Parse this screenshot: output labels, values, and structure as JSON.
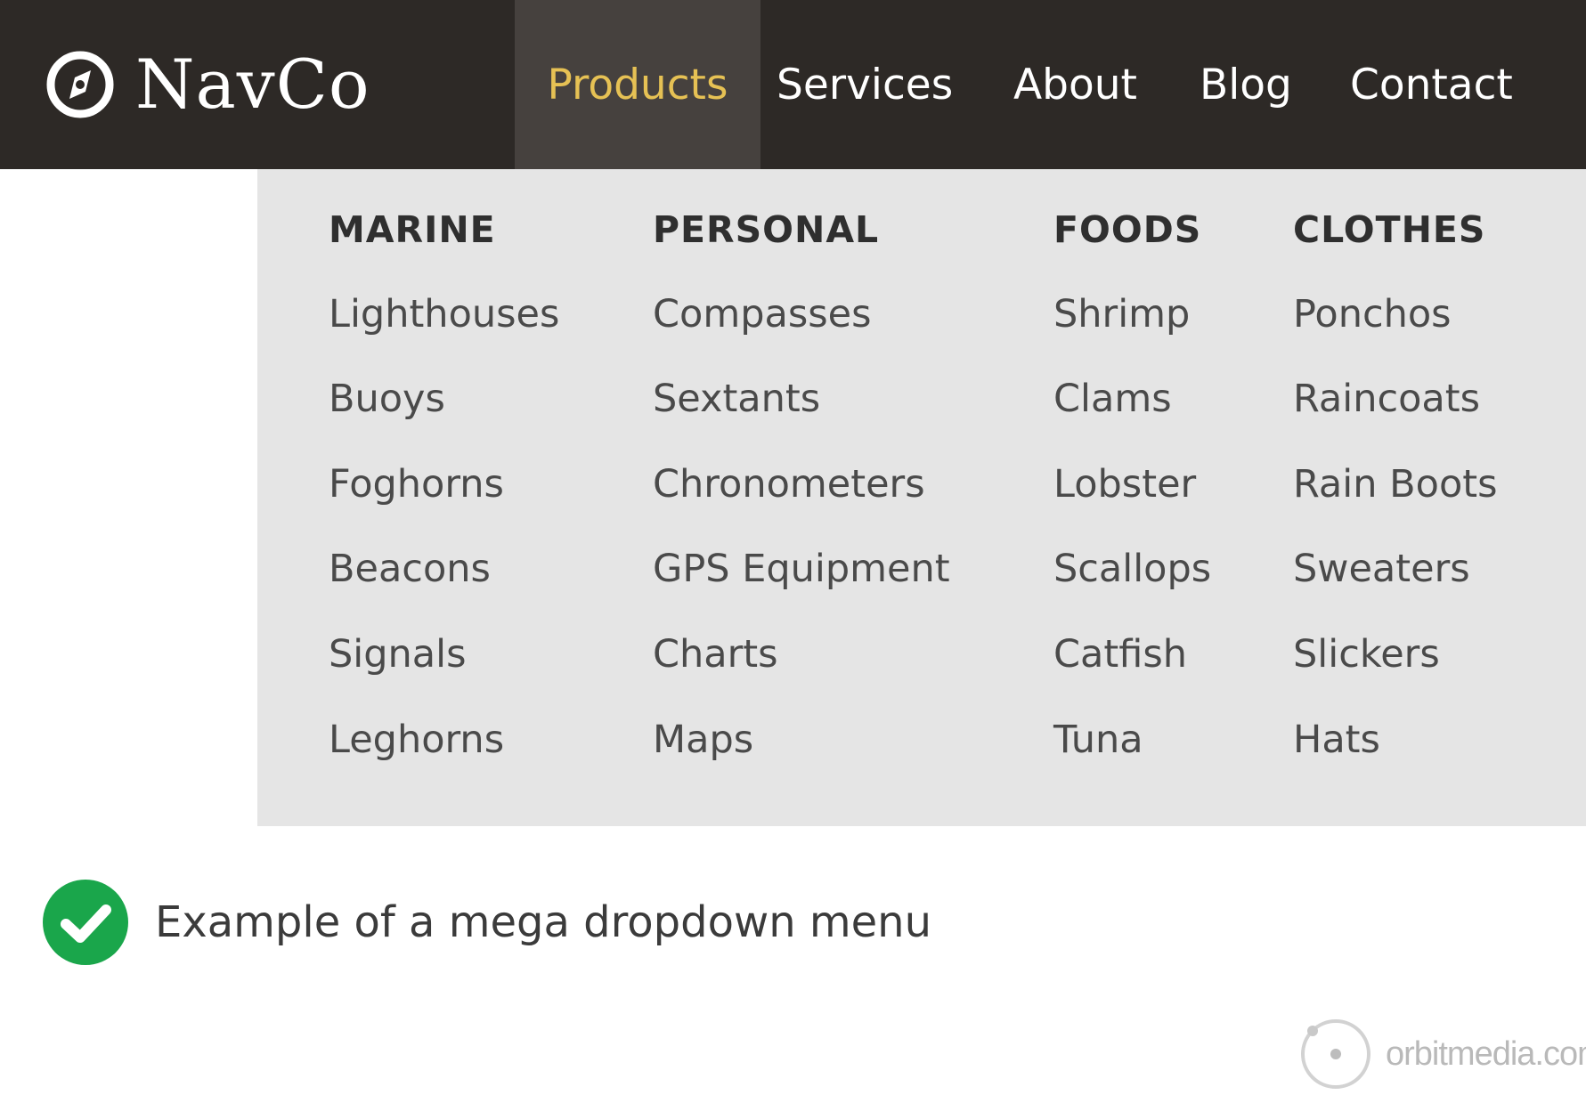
{
  "navbar": {
    "brand": {
      "name": "NavCo",
      "icon": "compass-icon"
    },
    "items": [
      {
        "label": "Products",
        "active": true
      },
      {
        "label": "Services",
        "active": false
      },
      {
        "label": "About",
        "active": false
      },
      {
        "label": "Blog",
        "active": false
      },
      {
        "label": "Contact",
        "active": false
      }
    ],
    "colors": {
      "background": "#2d2926",
      "active_background": "#46413e",
      "active_text": "#e6c154",
      "text": "#ffffff"
    }
  },
  "mega_menu": {
    "background": "#e5e5e5",
    "columns": [
      {
        "heading": "MARINE",
        "items": [
          "Lighthouses",
          "Buoys",
          "Foghorns",
          "Beacons",
          "Signals",
          "Leghorns"
        ]
      },
      {
        "heading": "PERSONAL",
        "items": [
          "Compasses",
          "Sextants",
          "Chronometers",
          "GPS Equipment",
          "Charts",
          "Maps"
        ]
      },
      {
        "heading": "FOODS",
        "items": [
          "Shrimp",
          "Clams",
          "Lobster",
          "Scallops",
          "Catfish",
          "Tuna"
        ]
      },
      {
        "heading": "CLOTHES",
        "items": [
          "Ponchos",
          "Raincoats",
          "Rain Boots",
          "Sweaters",
          "Slickers",
          "Hats"
        ]
      }
    ]
  },
  "caption": {
    "icon": "check-circle-icon",
    "icon_color": "#1aa64b",
    "text": "Example of a mega dropdown menu"
  },
  "watermark": {
    "icon": "orbit-icon",
    "text": "orbitmedia.com"
  }
}
